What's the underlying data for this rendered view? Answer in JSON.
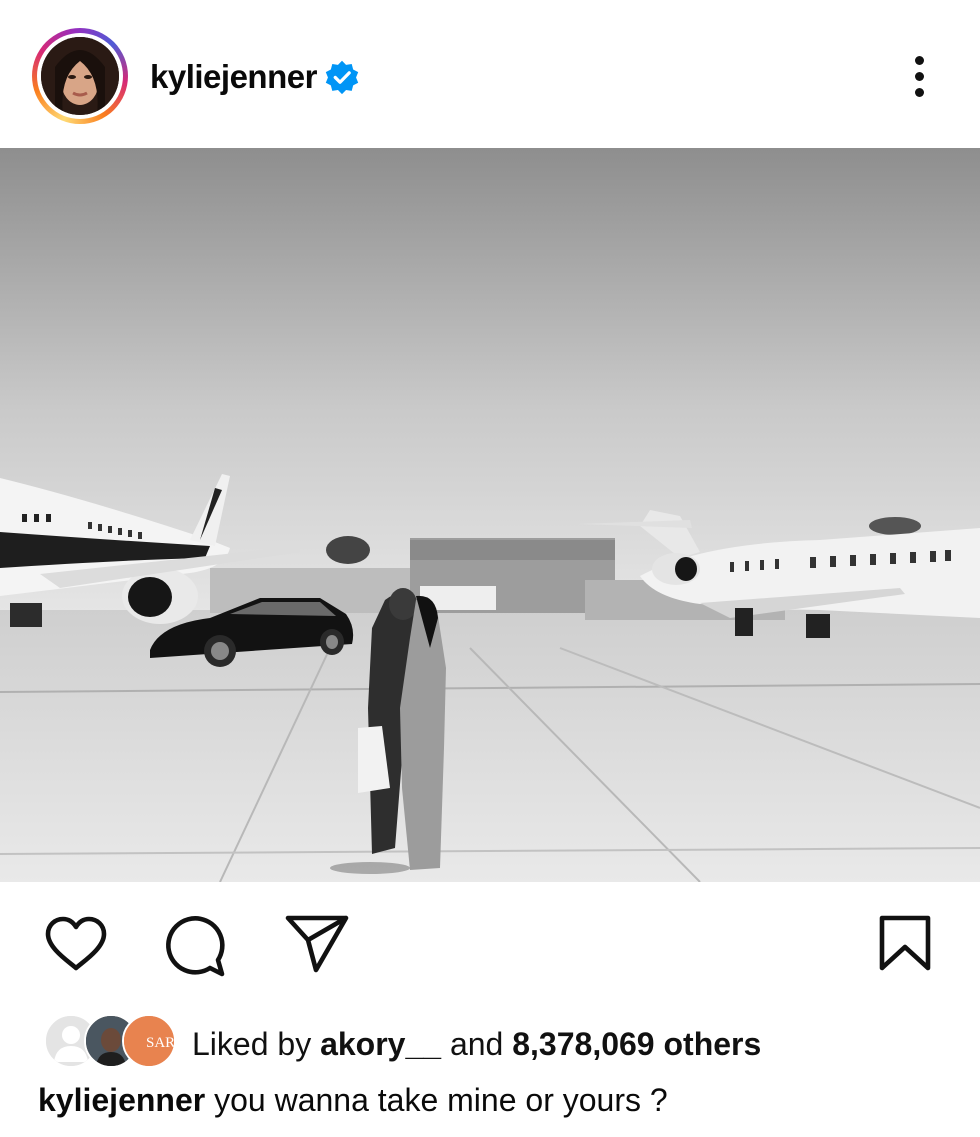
{
  "post": {
    "username": "kyliejenner",
    "verified": true,
    "photo_alt": "",
    "likes": {
      "prefix": "Liked by",
      "liker": "akory__",
      "conjunction": "and",
      "count": "8,378,069 others",
      "avatar_badge_text": "SAR"
    },
    "caption": {
      "username": "kyliejenner",
      "text": "you wanna take mine or yours ?"
    }
  },
  "icons": {
    "verified": "verified-badge-icon",
    "more": "more-vertical-icon",
    "like": "heart-icon",
    "comment": "comment-icon",
    "share": "send-icon",
    "save": "bookmark-icon"
  },
  "colors": {
    "verified_blue": "#0095f6",
    "text": "#0a0a0a",
    "background": "#ffffff"
  }
}
